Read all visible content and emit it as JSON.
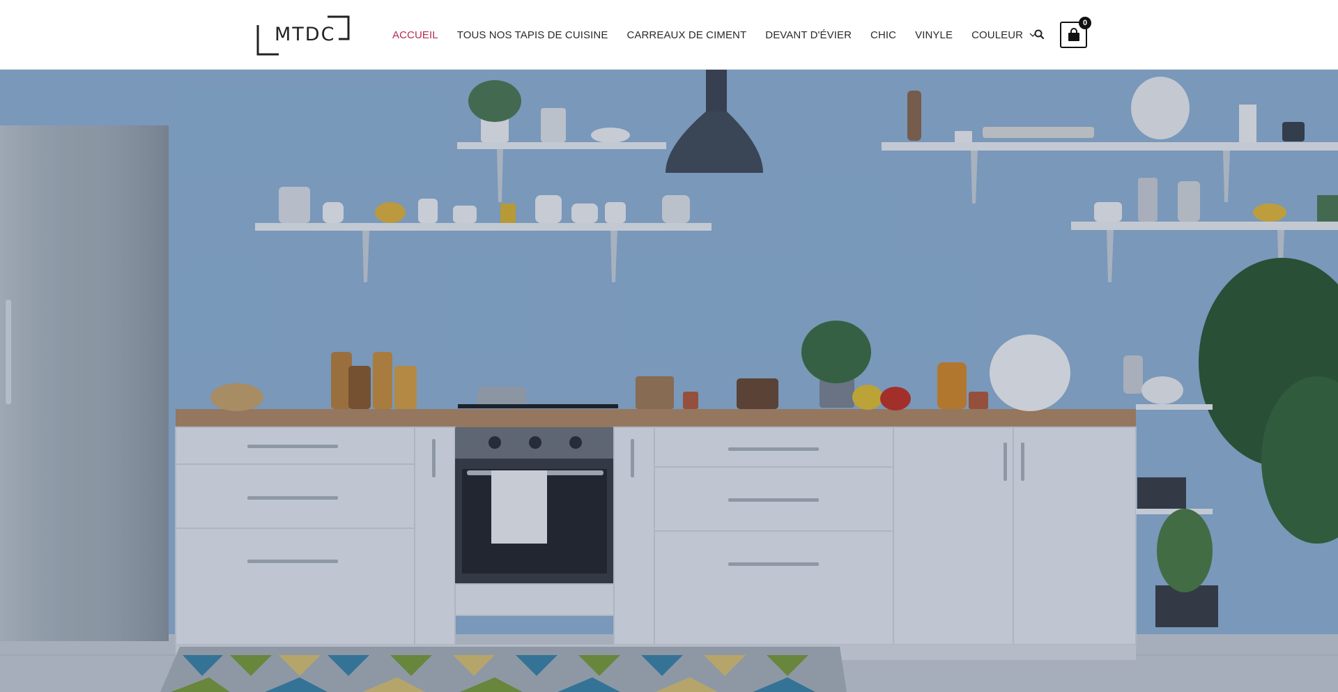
{
  "site": {
    "logo_text": "MTDC"
  },
  "nav": {
    "items": [
      {
        "label": "ACCUEIL",
        "active": true
      },
      {
        "label": "TOUS NOS TAPIS DE CUISINE",
        "active": false
      },
      {
        "label": "CARREAUX DE CIMENT",
        "active": false
      },
      {
        "label": "DEVANT D'ÉVIER",
        "active": false
      },
      {
        "label": "CHIC",
        "active": false
      },
      {
        "label": "VINYLE",
        "active": false
      },
      {
        "label": "COULEUR",
        "active": false,
        "has_dropdown": true
      }
    ]
  },
  "header_actions": {
    "search_icon": "search-icon",
    "cart_icon": "shopping-bag-icon",
    "cart_count": "0"
  },
  "colors": {
    "accent": "#b52a4e",
    "text": "#2a2a2a",
    "wall": "#8fb3d3"
  },
  "hero": {
    "image": "kitchen-photo"
  }
}
